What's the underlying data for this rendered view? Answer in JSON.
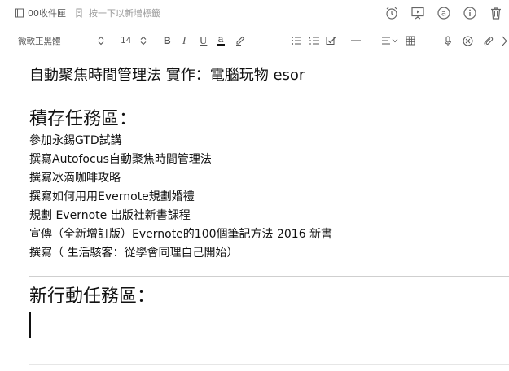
{
  "topbar": {
    "notebook_label": "00收件匣",
    "tag_placeholder": "按一下以新增標籤",
    "actions": [
      "reminder-icon",
      "present-icon",
      "at-icon",
      "info-icon",
      "trash-icon"
    ]
  },
  "toolbar": {
    "font_name": "微軟正黑體",
    "font_size": "14",
    "bold": "B",
    "italic": "I",
    "underline": "U",
    "text_color": "a"
  },
  "note": {
    "title_line": "自動聚焦時間管理法 實作：電腦玩物 esor",
    "backlog_heading": "積存任務區：",
    "backlog_items": [
      "參加永錫GTD試講",
      "撰寫Autofocus自動聚焦時間管理法",
      "撰寫冰滴咖啡攻略",
      "撰寫如何用用Evernote規劃婚禮",
      "規劃 Evernote 出版社新書課程",
      "宣傳（全新增訂版）Evernote的100個筆記方法 2016 新書",
      "撰寫（ 生活駭客：從學會同理自己開始）"
    ],
    "new_heading": "新行動任務區："
  }
}
